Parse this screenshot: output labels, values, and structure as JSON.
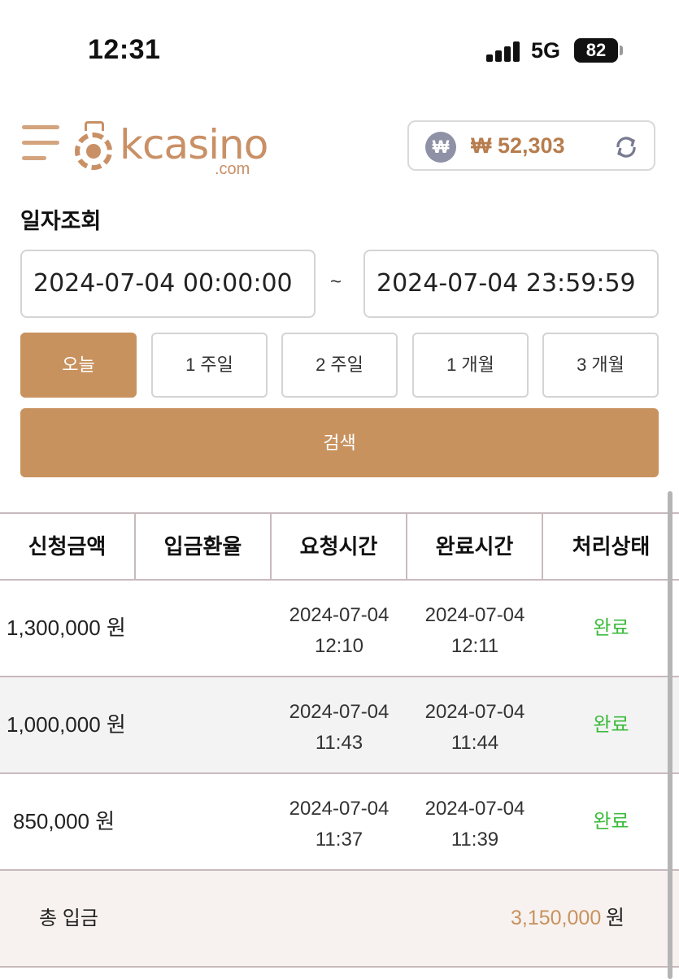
{
  "status_bar": {
    "time": "12:31",
    "network": "5G",
    "battery": "82"
  },
  "header": {
    "logo_text": "kcasino",
    "logo_sub": ".com",
    "currency_symbol": "₩",
    "balance": "₩ 52,303"
  },
  "filter": {
    "title": "일자조회",
    "start_date": "2024-07-04 00:00:00",
    "end_date": "2024-07-04 23:59:59",
    "separator": "~",
    "periods": [
      "오늘",
      "1 주일",
      "2 주일",
      "1 개월",
      "3 개월"
    ],
    "active_period": "오늘",
    "search_label": "검색"
  },
  "table": {
    "columns": [
      "신청금액",
      "입금환율",
      "요청시간",
      "완료시간",
      "처리상태"
    ],
    "rows": [
      {
        "amount": "1,300,000 원",
        "rate": "",
        "request_date": "2024-07-04",
        "request_time": "12:10",
        "complete_date": "2024-07-04",
        "complete_time": "12:11",
        "status": "완료"
      },
      {
        "amount": "1,000,000 원",
        "rate": "",
        "request_date": "2024-07-04",
        "request_time": "11:43",
        "complete_date": "2024-07-04",
        "complete_time": "11:44",
        "status": "완료"
      },
      {
        "amount": "850,000 원",
        "rate": "",
        "request_date": "2024-07-04",
        "request_time": "11:37",
        "complete_date": "2024-07-04",
        "complete_time": "11:39",
        "status": "완료"
      }
    ],
    "total_label": "총 입금",
    "total_value": "3,150,000",
    "total_unit": "원"
  },
  "colors": {
    "accent": "#c8925f",
    "status_done": "#3dbb3d",
    "border": "#c9b9bd"
  },
  "icons": [
    "hamburger-menu-icon",
    "casino-chip-icon",
    "won-coin-icon",
    "refresh-icon",
    "signal-icon",
    "battery-icon"
  ]
}
